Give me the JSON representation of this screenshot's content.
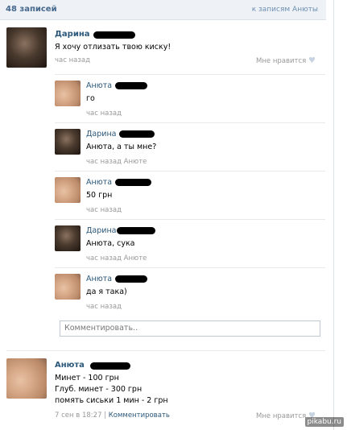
{
  "header": {
    "count": "48 записей",
    "to_link": "к записям Анюты"
  },
  "post1": {
    "author": "Дарина",
    "text": "Я хочу отлизать твою киску!",
    "time": "час назад",
    "like_label": "Мне нравится"
  },
  "comments": [
    {
      "author": "Анюта",
      "text": "го",
      "meta": "час назад"
    },
    {
      "author": "Дарина",
      "text": "Анюта, а ты мне?",
      "meta": "час назад Анюте"
    },
    {
      "author": "Анюта",
      "text": "50 грн",
      "meta": "час назад"
    },
    {
      "author": "Дарина",
      "text": "Анюта, сука",
      "meta": "час назад Анюте"
    },
    {
      "author": "Анюта",
      "text": "да я така)",
      "meta": "час назад"
    }
  ],
  "comment_input": {
    "placeholder": "Комментировать.."
  },
  "post2": {
    "author": "Анюта",
    "lines": [
      "Минет - 100 грн",
      "Глуб. минет - 300 грн",
      "помять сиськи 1 мин - 2 грн"
    ],
    "time": "7 сен в 18:27",
    "divider": "|",
    "comment_label": "Комментировать",
    "like_label": "Мне нравится"
  },
  "watermark": "pikabu.ru"
}
